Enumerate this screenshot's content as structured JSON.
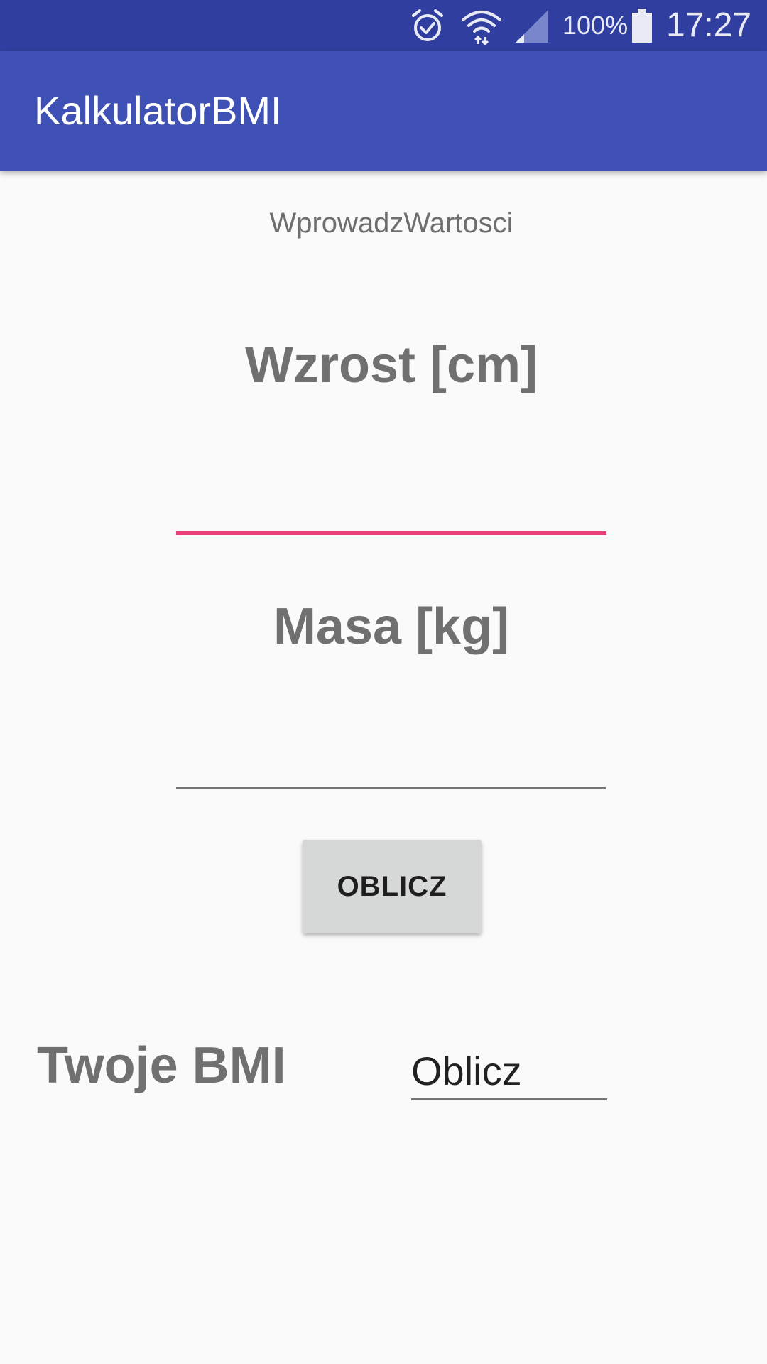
{
  "status_bar": {
    "icons": [
      "alarm-icon",
      "wifi-icon",
      "signal-icon",
      "battery-icon"
    ],
    "battery_percent": "100%",
    "time": "17:27",
    "background_color": "#303F9F"
  },
  "app_bar": {
    "title": "KalkulatorBMI",
    "background_color": "#3F51B5"
  },
  "form": {
    "subtitle": "WprowadzWartosci",
    "height_label": "Wzrost [cm]",
    "height_value": "",
    "mass_label": "Masa [kg]",
    "mass_value": "",
    "calculate_button": "OBLICZ",
    "focus_color": "#EC407A"
  },
  "result": {
    "label": "Twoje BMI",
    "value": "Oblicz"
  }
}
